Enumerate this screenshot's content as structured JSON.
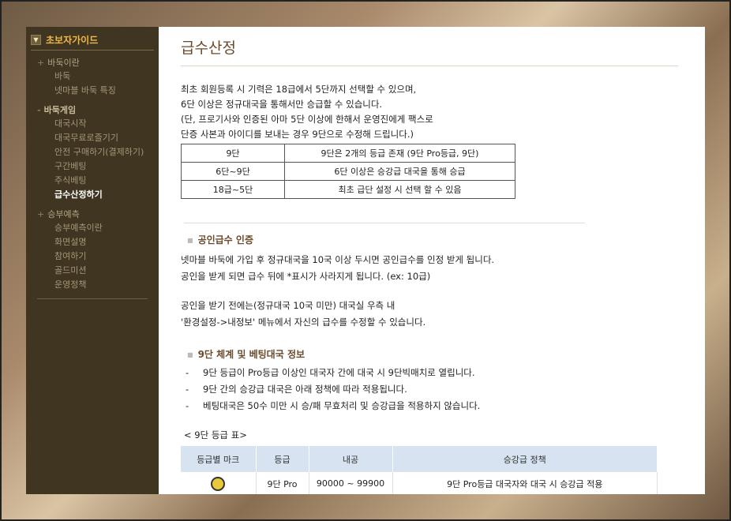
{
  "sidebar": {
    "header": "초보자가이드",
    "sections": [
      {
        "title": "바둑이란",
        "items": [
          "바둑",
          "넷마블 바둑 특징"
        ]
      },
      {
        "title": "바둑게임",
        "items": [
          "대국시작",
          "대국무료로즐기기",
          "안전 구매하기(결제하기)",
          "구간베팅",
          "주식베팅",
          "급수산정하기"
        ]
      },
      {
        "title": "승부예측",
        "items": [
          "승부예측이란",
          "화면설명",
          "참여하기",
          "골드미션",
          "운영정책"
        ]
      }
    ],
    "active_item": "급수산정하기"
  },
  "main": {
    "title": "급수산정",
    "intro": [
      "최초 회원등록 시 기력은 18급에서 5단까지 선택할 수 있으며,",
      "6단 이상은 정규대국을 통해서만 승급할 수 있습니다.",
      "(단, 프로기사와 인증된 아마 5단 이상에 한해서 운영진에게 팩스로",
      "단증 사본과 아이디를 보내는 경우 9단으로 수정해 드립니다.)"
    ],
    "grade_table": [
      [
        "9단",
        "9단은 2개의 등급 존재 (9단 Pro등급, 9단)"
      ],
      [
        "6단~9단",
        "6단 이상은 승강급 대국을 통해  승급"
      ],
      [
        "18급~5단",
        "최초 급단 설정 시 선택 할 수 있음"
      ]
    ],
    "cert": {
      "heading": "공인급수 인증",
      "p1": [
        "넷마블 바둑에 가입 후 정규대국을 10국 이상 두시면 공인급수를 인정 받게 됩니다.",
        "공인을 받게 되면 급수 뒤에 *표시가 사라지게 됩니다. (ex: 10급)"
      ],
      "p2": [
        "공인을 받기 전에는(정규대국 10국 미만) 대국실 우측 내",
        "'환경설정->내정보' 메뉴에서 자신의 급수를 수정할 수 있습니다."
      ]
    },
    "nine": {
      "heading": "9단 체계 및 베팅대국 정보",
      "items": [
        "9단 등급이 Pro등급 이상인 대국자 간에 대국 시  9단빅매치로 열립니다.",
        "9단 간의 승강급 대국은 아래 정책에 따라 적용됩니다.",
        "베팅대국은 50수 미만 시 승/패 무효처리 및 승강급을 적용하지 않습니다."
      ],
      "dash": "-",
      "table_caption": "< 9단 등급 표>",
      "table_headers": [
        "등급별 마크",
        "등급",
        "내공",
        "승강급 정책"
      ],
      "table_rows": [
        {
          "mark_icon": "grade-mark-icon",
          "grade": "9단 Pro",
          "power": "90000 ~ 99900",
          "policy": "9단 Pro등급 대국자와 대국 시 승강급 적용"
        }
      ]
    }
  }
}
